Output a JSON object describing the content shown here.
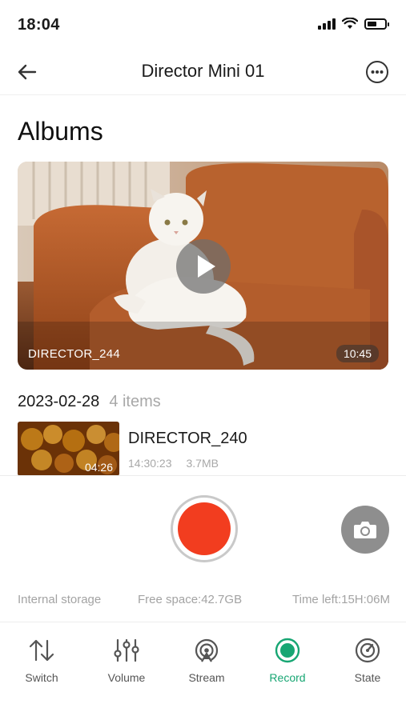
{
  "status_bar": {
    "time": "18:04",
    "icons": [
      "cellular-signal-icon",
      "wifi-icon",
      "battery-icon"
    ],
    "battery_level": 0.55
  },
  "header": {
    "title": "Director Mini 01",
    "back_icon": "arrow-left-icon",
    "more_icon": "more-options-icon"
  },
  "page": {
    "title": "Albums"
  },
  "featured": {
    "name": "DIRECTOR_244",
    "duration": "10:45",
    "play_icon": "play-icon"
  },
  "groups": [
    {
      "date": "2023-02-28",
      "count": "4 items",
      "items": [
        {
          "name": "DIRECTOR_240",
          "time": "14:30:23",
          "size": "3.7MB",
          "duration": "04:26"
        }
      ]
    }
  ],
  "controls": {
    "record_icon": "record-button-icon",
    "camera_icon": "camera-icon",
    "record_color": "#f23d1f"
  },
  "storage": {
    "label": "Internal storage",
    "free_space": "Free space:42.7GB",
    "time_left": "Time left:15H:06M"
  },
  "tabs": [
    {
      "label": "Switch",
      "icon": "switch-arrows-icon",
      "active": false
    },
    {
      "label": "Volume",
      "icon": "volume-sliders-icon",
      "active": false
    },
    {
      "label": "Stream",
      "icon": "stream-broadcast-icon",
      "active": false
    },
    {
      "label": "Record",
      "icon": "record-icon",
      "active": true
    },
    {
      "label": "State",
      "icon": "state-gauge-icon",
      "active": false
    }
  ],
  "colors": {
    "accent": "#17a673",
    "record": "#f23d1f",
    "muted_text": "#a8a8a8"
  }
}
